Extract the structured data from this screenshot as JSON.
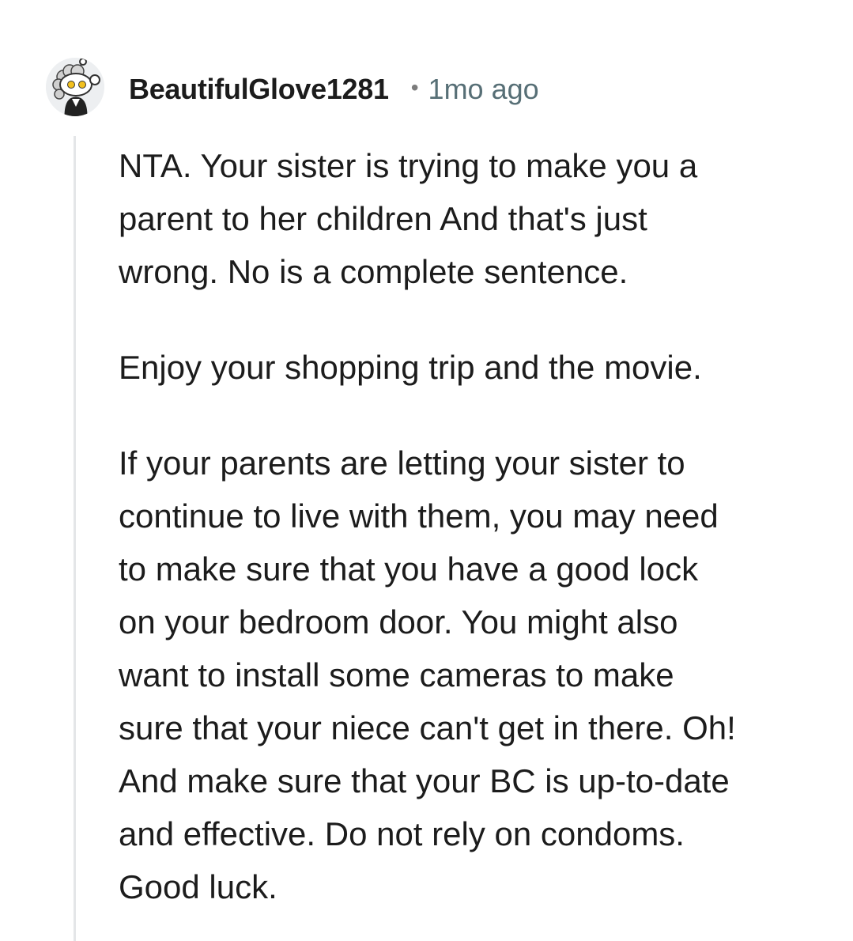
{
  "comment": {
    "author": "BeautifulGlove1281",
    "separator": "•",
    "timestamp": "1mo ago",
    "avatar_icon": "snoo-avatar-icon",
    "paragraphs": [
      {
        "lines": [
          "NTA. Your sister is trying to make you a",
          "parent to her children And that's just",
          "wrong. No is a complete sentence."
        ]
      },
      {
        "lines": [
          "Enjoy your shopping trip and the movie."
        ]
      },
      {
        "lines": [
          "If your parents are letting your sister to",
          "continue to live with them, you may need",
          "to make sure that you have a good lock",
          "on your bedroom door. You might also",
          "want to install some cameras to make",
          "sure that your niece can't get in there. Oh!",
          "And make sure that your BC is up-to-date",
          "and effective. Do not rely on condoms.",
          "Good luck."
        ]
      }
    ]
  },
  "colors": {
    "text": "#1c1c1c",
    "meta": "#576f76",
    "thread_line": "#e4e6e8",
    "background": "#ffffff"
  }
}
